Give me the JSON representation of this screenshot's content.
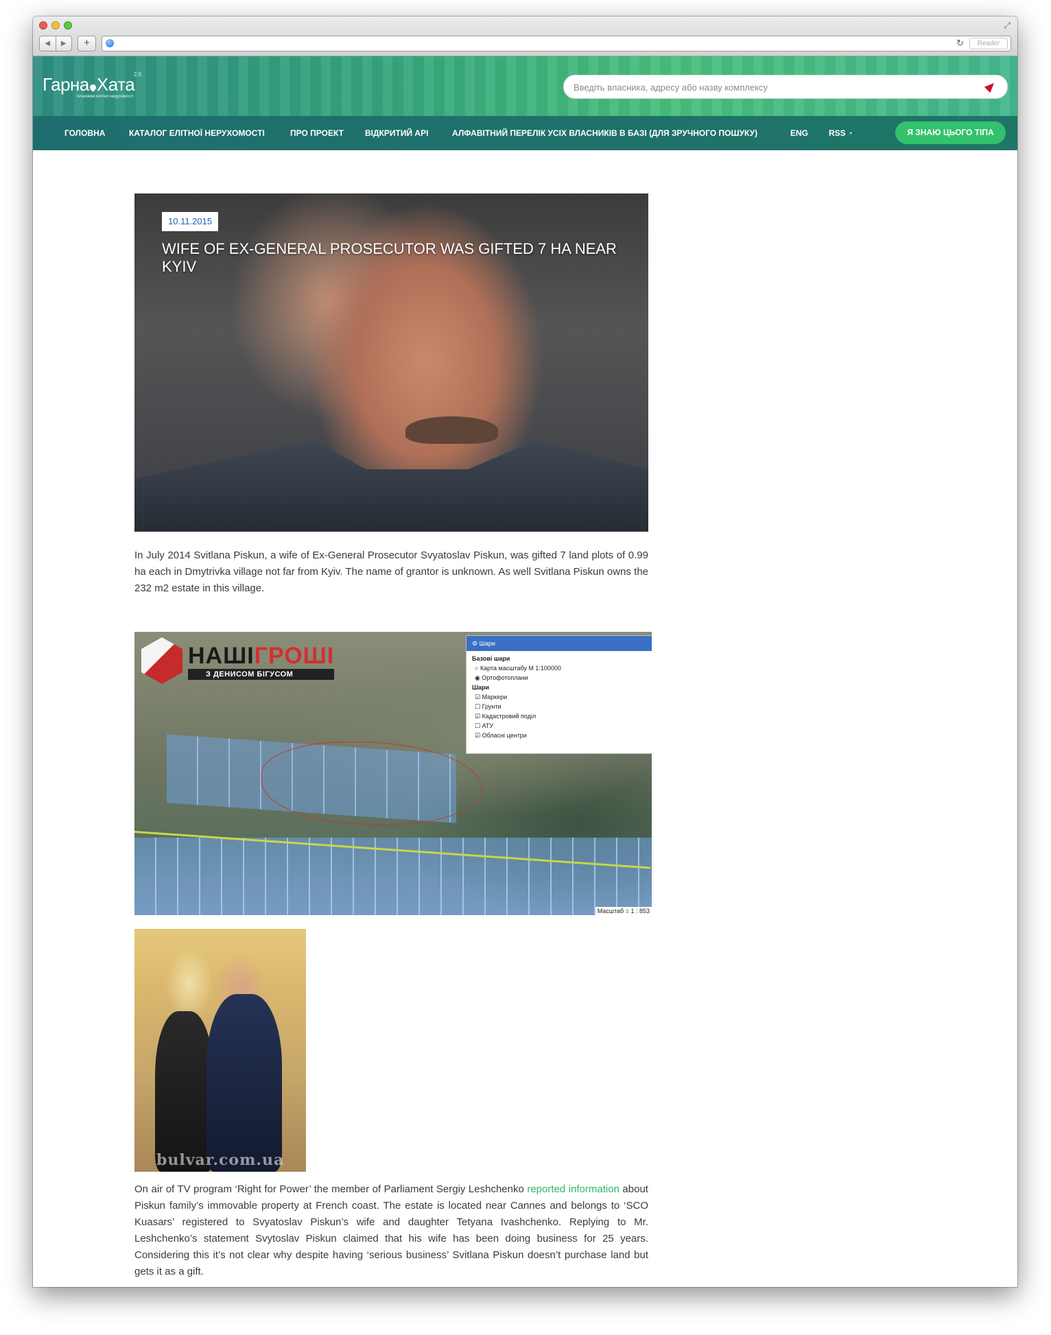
{
  "browser": {
    "reader_label": "Reader",
    "back_glyph": "◀",
    "forward_glyph": "▶",
    "new_tab_glyph": "+",
    "reload_glyph": "↻",
    "resize_glyph": "⤢"
  },
  "site": {
    "logo_part1": "Гарна",
    "logo_part2": "Хата",
    "logo_version": "2.0",
    "logo_tagline": "Власники елітної нерухомості",
    "search_placeholder": "Введіть власника, адресу або назву комплексу",
    "nav": [
      {
        "label": "ГОЛОВНА"
      },
      {
        "label": "КАТАЛОГ ЕЛІТНОЇ НЕРУХОМОСТІ"
      },
      {
        "label": "ПРО ПРОЕКТ"
      },
      {
        "label": "ВІДКРИТИЙ API"
      },
      {
        "label": "АЛФАВІТНИЙ ПЕРЕЛІК УСІХ ВЛАСНИКІВ В БАЗІ (ДЛЯ ЗРУЧНОГО ПОШУКУ)"
      },
      {
        "label": "ENG"
      },
      {
        "label": "RSS"
      }
    ],
    "rss_glyph": "◔",
    "cta_label": "Я ЗНАЮ ЦЬОГО ТІПА",
    "accent_color": "#33c16d",
    "nav_color": "#1f7168"
  },
  "article": {
    "date": "10.11.2015",
    "title": "WIFE OF EX-GENERAL PROSECUTOR WAS GIFTED 7 HA NEAR KYIV",
    "paragraph1": "In July 2014 Svitlana Piskun, a wife of Ex-General Prosecutor Svyatoslav Piskun, was gifted 7 land plots of 0.99 ha each in Dmytrivka village not far from Kyiv. The name of grantor is unknown. As well Svitlana Piskun owns the 232 m2 estate in this village.",
    "paragraph2_before": "On air of TV program ‘Right for Power’ the member of Parliament Sergiy Leshchenko ",
    "paragraph2_link": "reported information",
    "paragraph2_after": " about Piskun family’s immovable property at French coast. The estate is located near Cannes and belongs to ‘SCO Kuasars’ registered to Svyatoslav Piskun’s wife and daughter Tetyana Ivashchenko. Replying to Mr. Leshchenko’s statement Svytoslav Piskun claimed that his wife has been doing business for 25 years. Considering this it’s not clear why despite having ‘serious business’ Svitlana Piskun doesn’t purchase land but gets it as a gift."
  },
  "map": {
    "brand_title_a": "НАШІ",
    "brand_title_b": "ГРОШІ",
    "brand_sub": "З ДЕНИСОМ БІГУСОМ",
    "panel_title": "Шари",
    "panel_gear_glyph": "⚙",
    "base_group": "Базові шари",
    "base_layers": [
      "Карта масштабу М 1:100000",
      "Ортофотоплани"
    ],
    "layers_group": "Шари",
    "layers": [
      "Маркери",
      "Грунти",
      "Кадастровий поділ",
      "АТУ",
      "Обласні центри"
    ],
    "checked_layers": [
      "Маркери",
      "Кадастровий поділ",
      "Обласні центри"
    ],
    "selected_base": "Ортофотоплани",
    "scale_label": "Масштаб = 1 : 853"
  },
  "photo": {
    "watermark": "bulvar.com.ua"
  }
}
